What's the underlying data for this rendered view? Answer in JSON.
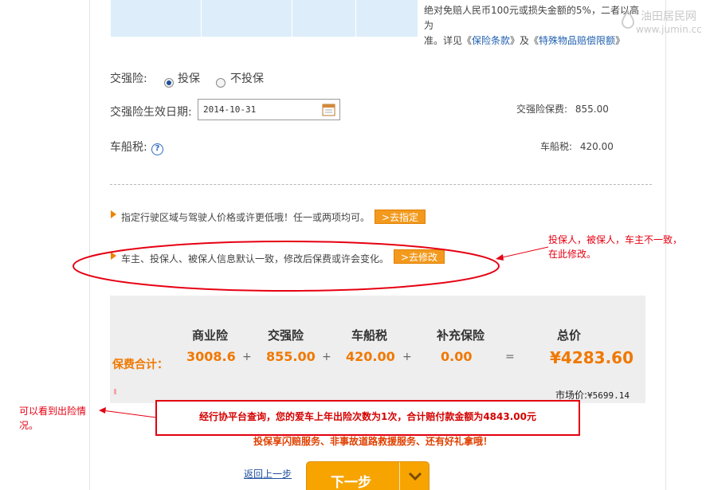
{
  "top_note": {
    "line1": "绝对免赔人民币100元或损失金额的5%，二者以高为",
    "line2_prefix": "准。详见《",
    "link_terms": "保险条款",
    "line2_mid": "》及《",
    "link_special": "特殊物品赔偿限额",
    "line2_suffix": "》"
  },
  "watermark": {
    "line1": "油田居民网",
    "line2": "www.jumin.cc"
  },
  "compulsory": {
    "label": "交强险:",
    "option_buy": "投保",
    "option_skip": "不投保",
    "selected": "投保",
    "date_label": "交强险生效日期:",
    "date_value": "2014-10-31",
    "fee_label": "交强险保费:",
    "fee_value": "855.00"
  },
  "vessel_tax": {
    "label": "车船税:",
    "fee_label": "车船税:",
    "fee_value": "420.00"
  },
  "tips": {
    "tip1_text": "指定行驶区域与驾驶人价格或许更低哦！任一或两项均可。",
    "tip1_button": ">去指定",
    "tip2_text": "车主、投保人、被保人信息默认一致，修改后保费或许会变化。",
    "tip2_button": ">去修改"
  },
  "summary": {
    "label": "保费合计：",
    "headers": [
      "商业险",
      "交强险",
      "车船税",
      "补充保险",
      "总价"
    ],
    "values": [
      "3008.6",
      "855.00",
      "420.00",
      "0.00",
      "¥4283.60"
    ],
    "ops": [
      "+",
      "+",
      "+",
      "+",
      "="
    ],
    "market_label": "市场价:",
    "market_value": "¥5699.14"
  },
  "claim_info": "经行协平台查询，您的爱车上年出险次数为1次，合计赔付款金额为4843.00元",
  "service": "投保享闪赔服务、非事故道路救援服务、还有好礼拿哦！",
  "nav": {
    "back": "返回上一步",
    "next": "下一步"
  },
  "annotations": {
    "right_note": "投保人，被保人，车主不一致，在此修改。",
    "left_note": "可以看到出险情况。"
  },
  "colors": {
    "accent_orange": "#f07800",
    "annotation_red": "#e60012",
    "link_blue": "#1f5fb0"
  }
}
